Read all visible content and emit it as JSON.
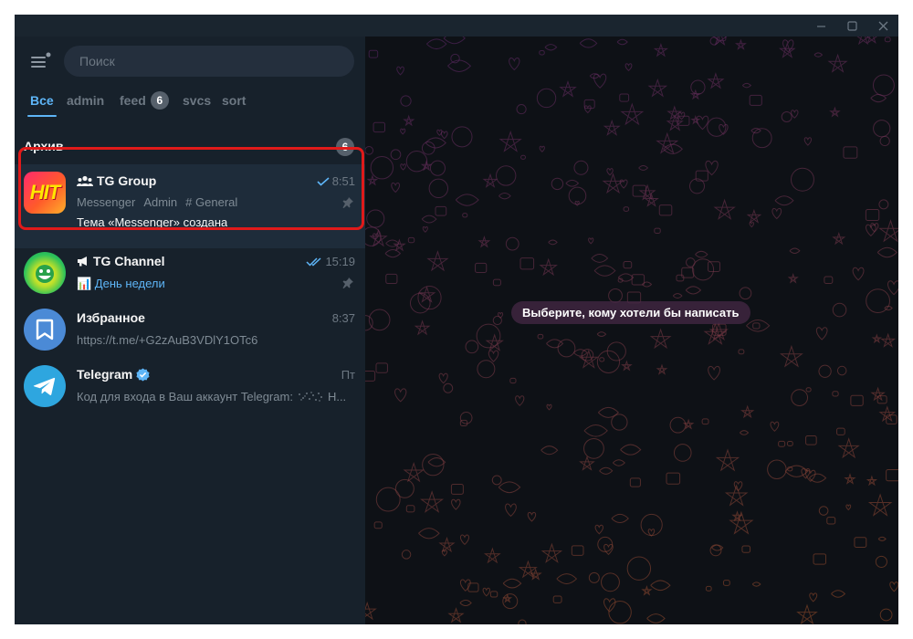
{
  "window": {
    "controls": [
      "minimize-icon",
      "maximize-icon",
      "close-icon"
    ]
  },
  "search": {
    "placeholder": "Поиск"
  },
  "tabs": [
    {
      "label": "Все",
      "active": true
    },
    {
      "label": "admin"
    },
    {
      "label": "feed",
      "badge": "6"
    },
    {
      "label": "svcs"
    },
    {
      "label": "sort"
    }
  ],
  "archive": {
    "label": "Архив",
    "count": "6"
  },
  "chats": [
    {
      "name": "TG Group",
      "type_icon": "group-icon",
      "time": "8:51",
      "status_icon": "single-check-icon",
      "topics": [
        "Messenger",
        "Admin",
        "# General"
      ],
      "message": "Тема «Messenger» создана",
      "pinned": true,
      "avatar_text": "HIT"
    },
    {
      "name": "TG Channel",
      "type_icon": "megaphone-icon",
      "time": "15:19",
      "status_icon": "double-check-icon",
      "message": "📊 День недели",
      "pinned": true
    },
    {
      "name": "Избранное",
      "time": "8:37",
      "message": "https://t.me/+G2zAuB3VDlY1OTc6",
      "avatar_icon": "bookmark-icon"
    },
    {
      "name": "Telegram",
      "verified": true,
      "time": "Пт",
      "message_prefix": "Код для входа в Ваш аккаунт Telegram:",
      "message_suffix": "Н...",
      "avatar_icon": "telegram-plane-icon"
    }
  ],
  "main": {
    "hint": "Выберите, кому хотели бы написать"
  },
  "colors": {
    "sidebar_bg": "#17212b",
    "accent": "#5eb5f7",
    "highlight": "#e01a1a",
    "hint_bg": "#46284699"
  }
}
